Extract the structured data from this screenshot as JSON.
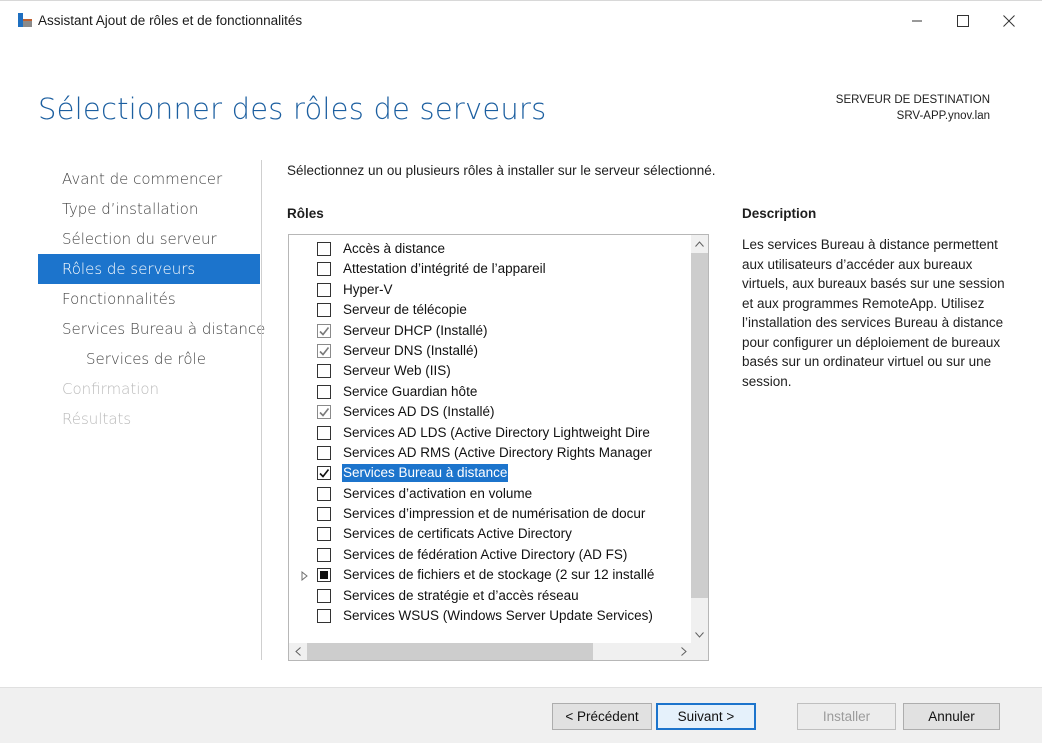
{
  "window": {
    "title": "Assistant Ajout de rôles et de fonctionnalités",
    "minimize_icon": "minimize-icon",
    "maximize_icon": "maximize-icon",
    "close_icon": "close-icon"
  },
  "page": {
    "heading": "Sélectionner des rôles de serveurs",
    "destination_label": "SERVEUR DE DESTINATION",
    "destination_server": "SRV-APP.ynov.lan"
  },
  "nav": {
    "items": [
      {
        "label": "Avant de commencer",
        "state": "normal"
      },
      {
        "label": "Type d’installation",
        "state": "normal"
      },
      {
        "label": "Sélection du serveur",
        "state": "normal"
      },
      {
        "label": "Rôles de serveurs",
        "state": "active"
      },
      {
        "label": "Fonctionnalités",
        "state": "normal"
      },
      {
        "label": "Services Bureau à distance",
        "state": "normal"
      },
      {
        "label": "Services de rôle",
        "state": "sub"
      },
      {
        "label": "Confirmation",
        "state": "disabled"
      },
      {
        "label": "Résultats",
        "state": "disabled"
      }
    ]
  },
  "main": {
    "instruction": "Sélectionnez un ou plusieurs rôles à installer sur le serveur sélectionné.",
    "roles_header": "Rôles",
    "description_header": "Description",
    "description_text": "Les services Bureau à distance permettent aux utilisateurs d’accéder aux bureaux virtuels, aux bureaux basés sur une session et aux programmes RemoteApp. Utilisez l’installation des services Bureau à distance pour configurer un déploiement de bureaux basés sur un ordinateur virtuel ou sur une session.",
    "roles": [
      {
        "label": "Accès à distance",
        "state": "unchecked"
      },
      {
        "label": "Attestation d’intégrité de l’appareil",
        "state": "unchecked"
      },
      {
        "label": "Hyper-V",
        "state": "unchecked"
      },
      {
        "label": "Serveur de télécopie",
        "state": "unchecked"
      },
      {
        "label": "Serveur DHCP (Installé)",
        "state": "installed"
      },
      {
        "label": "Serveur DNS (Installé)",
        "state": "installed"
      },
      {
        "label": "Serveur Web (IIS)",
        "state": "unchecked"
      },
      {
        "label": "Service Guardian hôte",
        "state": "unchecked"
      },
      {
        "label": "Services AD DS (Installé)",
        "state": "installed"
      },
      {
        "label": "Services AD LDS (Active Directory Lightweight Dire",
        "state": "unchecked"
      },
      {
        "label": "Services AD RMS (Active Directory Rights Manager",
        "state": "unchecked"
      },
      {
        "label": "Services Bureau à distance",
        "state": "checked",
        "selected": true
      },
      {
        "label": "Services d’activation en volume",
        "state": "unchecked"
      },
      {
        "label": "Services d’impression et de numérisation de docur",
        "state": "unchecked"
      },
      {
        "label": "Services de certificats Active Directory",
        "state": "unchecked"
      },
      {
        "label": "Services de fédération Active Directory (AD FS)",
        "state": "unchecked"
      },
      {
        "label": "Services de fichiers et de stockage (2 sur 12 installé",
        "state": "partial",
        "expandable": true
      },
      {
        "label": "Services de stratégie et d’accès réseau",
        "state": "unchecked"
      },
      {
        "label": "Services WSUS (Windows Server Update Services)",
        "state": "unchecked"
      }
    ]
  },
  "footer": {
    "previous": "< Précédent",
    "next": "Suivant >",
    "install": "Installer",
    "cancel": "Annuler"
  },
  "colors": {
    "accent": "#1c74cc",
    "heading": "#1c5fa0"
  }
}
